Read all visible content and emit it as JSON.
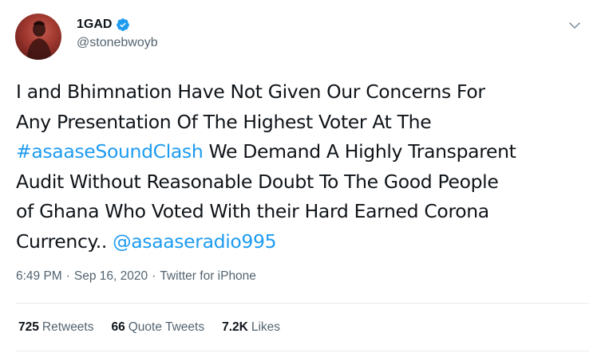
{
  "user": {
    "display_name": "1GAD",
    "handle": "@stonebwoyb",
    "verified": true
  },
  "tweet": {
    "lines": [
      [
        {
          "text": "I and Bhimnation Have Not Given Our Concerns For",
          "type": "text"
        }
      ],
      [
        {
          "text": "Any Presentation Of The Highest Voter At The",
          "type": "text"
        }
      ],
      [
        {
          "text": "#asaaseSoundClash",
          "type": "link"
        },
        {
          "text": " We Demand A Highly Transparent",
          "type": "text"
        }
      ],
      [
        {
          "text": "Audit Without Reasonable Doubt To The Good People",
          "type": "text"
        }
      ],
      [
        {
          "text": "of Ghana Who Voted With their Hard Earned Corona",
          "type": "text"
        }
      ],
      [
        {
          "text": "Currency.. ",
          "type": "text"
        },
        {
          "text": "@asaaseradio995",
          "type": "link"
        }
      ]
    ]
  },
  "meta": {
    "time": "6:49 PM",
    "separator": "·",
    "date": "Sep 16, 2020",
    "source": "Twitter for iPhone"
  },
  "stats": {
    "retweets_count": "725",
    "retweets_label": "Retweets",
    "quotes_count": "66",
    "quotes_label": "Quote Tweets",
    "likes_count": "7.2K",
    "likes_label": "Likes"
  },
  "colors": {
    "link": "#1d9bf0",
    "secondary_text": "#536471",
    "verified_badge": "#1d9bf0"
  },
  "icons": {
    "verified": "verified-badge-icon",
    "caret": "chevron-down-icon"
  }
}
